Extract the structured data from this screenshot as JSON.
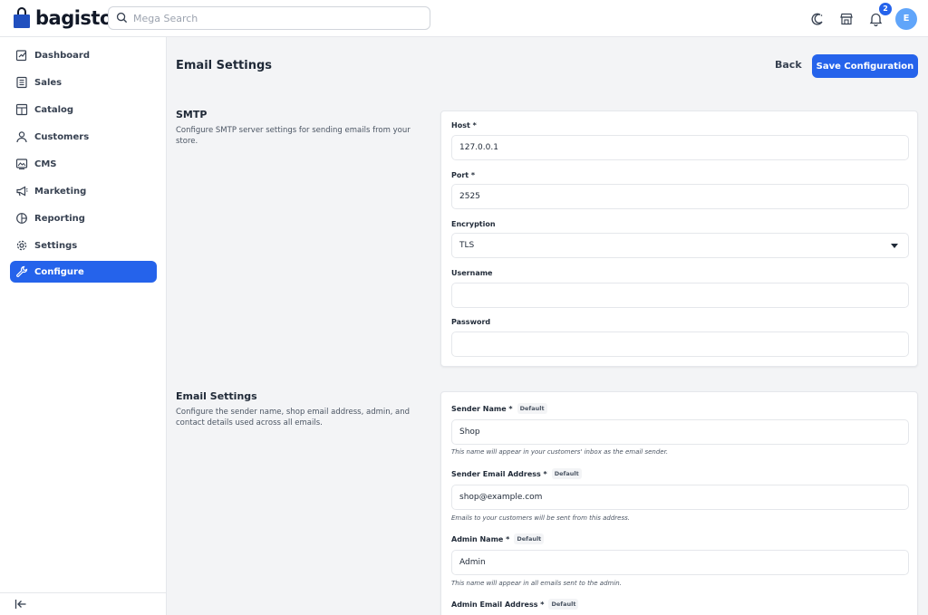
{
  "header": {
    "logo_text": "bagisto",
    "search_placeholder": "Mega Search",
    "notification_count": "2",
    "avatar_initial": "E"
  },
  "sidebar": {
    "items": [
      {
        "label": "Dashboard",
        "icon": "dashboard-icon"
      },
      {
        "label": "Sales",
        "icon": "sales-icon"
      },
      {
        "label": "Catalog",
        "icon": "catalog-icon"
      },
      {
        "label": "Customers",
        "icon": "customers-icon"
      },
      {
        "label": "CMS",
        "icon": "cms-icon"
      },
      {
        "label": "Marketing",
        "icon": "marketing-icon"
      },
      {
        "label": "Reporting",
        "icon": "reporting-icon"
      },
      {
        "label": "Settings",
        "icon": "gear-icon"
      },
      {
        "label": "Configure",
        "icon": "wrench-icon",
        "active": true
      }
    ]
  },
  "main": {
    "title": "Email Settings",
    "back_label": "Back",
    "save_label": "Save Configuration",
    "smtp": {
      "title": "SMTP",
      "description": "Configure SMTP server settings for sending emails from your store.",
      "host_label": "Host *",
      "host_value": "127.0.0.1",
      "port_label": "Port *",
      "port_value": "2525",
      "encryption_label": "Encryption",
      "encryption_value": "TLS",
      "username_label": "Username",
      "username_value": "",
      "password_label": "Password",
      "password_value": ""
    },
    "email": {
      "title": "Email Settings",
      "description": "Configure the sender name, shop email address, admin, and contact details used across all emails.",
      "default_tag": "Default",
      "sender_name_label": "Sender Name *",
      "sender_name_value": "Shop",
      "sender_name_hint": "This name will appear in your customers' inbox as the email sender.",
      "sender_email_label": "Sender Email Address *",
      "sender_email_value": "shop@example.com",
      "sender_email_hint": "Emails to your customers will be sent from this address.",
      "admin_name_label": "Admin Name *",
      "admin_name_value": "Admin",
      "admin_name_hint": "This name will appear in all emails sent to the admin.",
      "admin_email_label": "Admin Email Address *"
    }
  },
  "colors": {
    "accent": "#2563eb",
    "avatar": "#60a5fa"
  }
}
